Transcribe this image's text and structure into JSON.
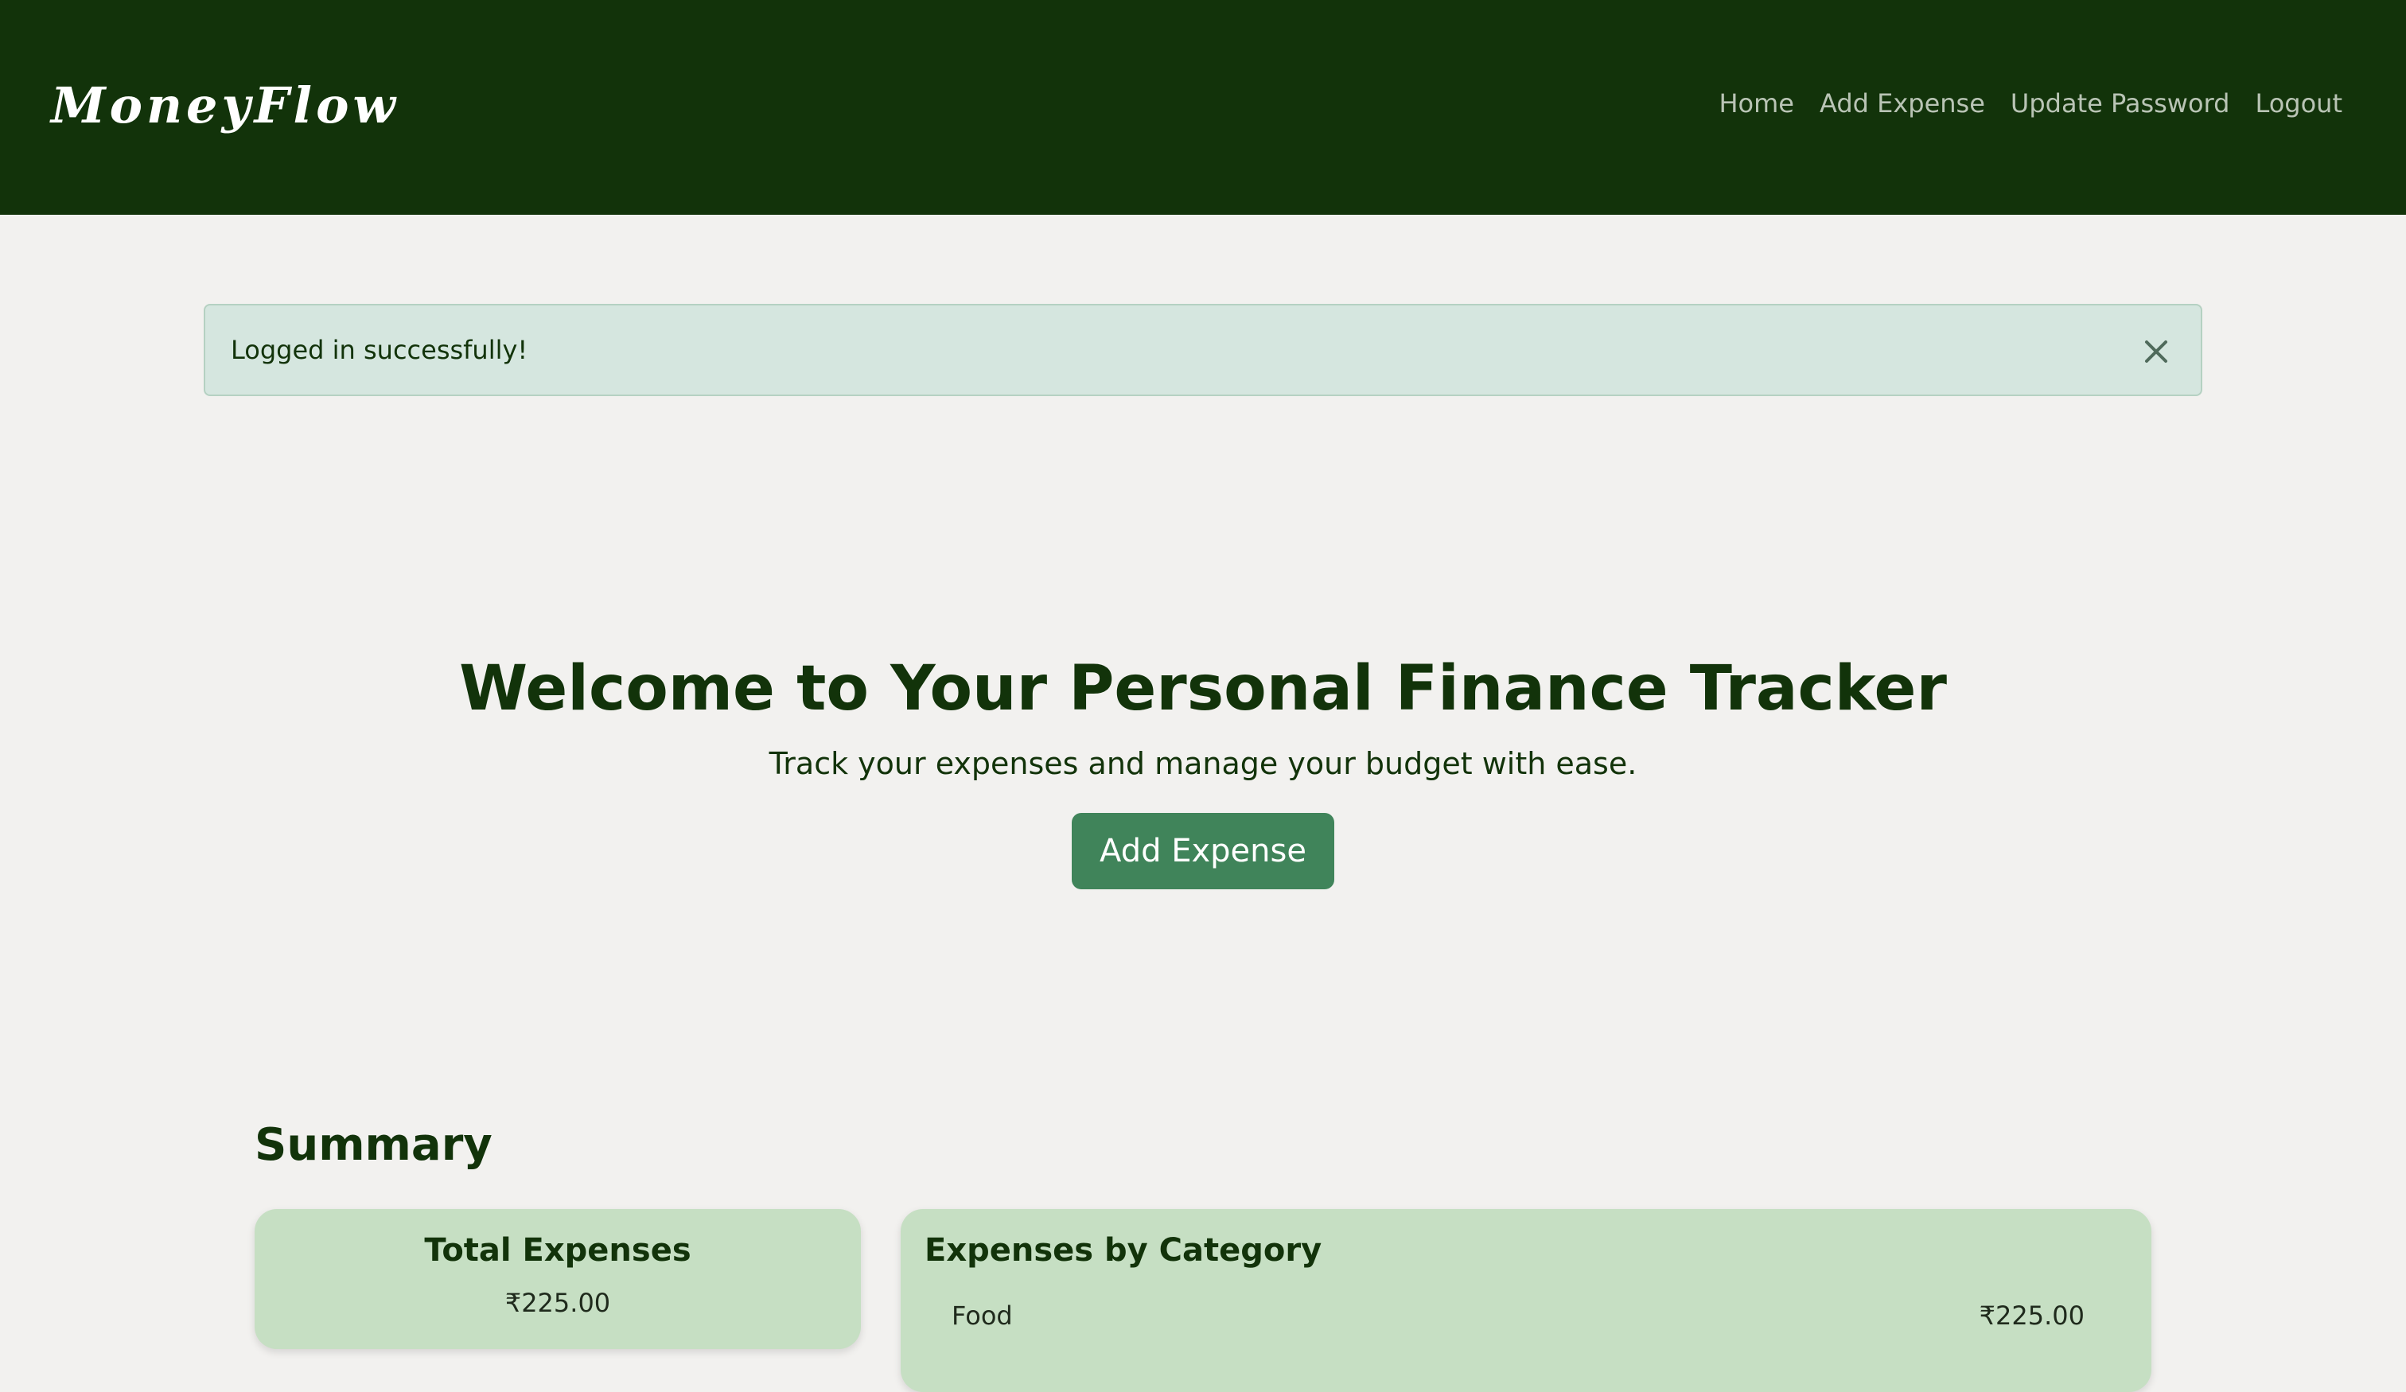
{
  "navbar": {
    "brand": "MoneyFlow",
    "links": [
      "Home",
      "Add Expense",
      "Update Password",
      "Logout"
    ]
  },
  "alert": {
    "message": "Logged in successfully!",
    "close_icon": "close-icon"
  },
  "hero": {
    "title": "Welcome to Your Personal Finance Tracker",
    "subtitle": "Track your expenses and manage your budget with ease.",
    "button_label": "Add Expense"
  },
  "summary": {
    "title": "Summary",
    "total": {
      "title": "Total Expenses",
      "value": "₹225.00"
    },
    "by_category": {
      "title": "Expenses by Category",
      "items": [
        {
          "category": "Food",
          "amount": "₹225.00"
        }
      ]
    }
  },
  "colors": {
    "navbar_bg": "#12330a",
    "page_bg": "#f2f1ef",
    "accent_button": "#40845a",
    "card_bg": "#c6dfc3",
    "alert_bg": "#d5e6df",
    "heading_text": "#12330a"
  }
}
